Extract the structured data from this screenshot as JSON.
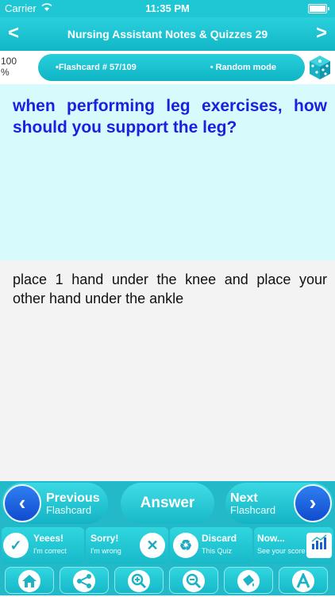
{
  "status": {
    "carrier": "Carrier",
    "time": "11:35 PM"
  },
  "nav": {
    "title": "Nursing Assistant Notes & Quizzes 29",
    "back": "<",
    "forward": ">"
  },
  "info": {
    "progress": "100 %",
    "flashcard_label": "•Flashcard #  57/109",
    "mode_label": "• Random mode"
  },
  "question": "when performing leg exercises, how should you support the leg?",
  "answer": "place 1 hand under the knee and place your other hand under the ankle",
  "controls": {
    "previous_title": "Previous",
    "previous_sub": "Flashcard",
    "answer_label": "Answer",
    "next_title": "Next",
    "next_sub": "Flashcard",
    "yeees_title": "Yeees!",
    "yeees_sub": "I'm correct",
    "sorry_title": "Sorry!",
    "sorry_sub": "I'm wrong",
    "discard_title": "Discard",
    "discard_sub": "This Quiz",
    "now_title": "Now...",
    "now_sub": "See your score"
  },
  "colors": {
    "accent": "#1ec7d3",
    "question_text": "#1c1ee0",
    "question_bg": "#d7fbfc"
  },
  "icons": [
    "wifi-icon",
    "battery-icon",
    "dice-icon",
    "check-icon",
    "cross-icon",
    "recycle-icon",
    "chart-icon",
    "home-icon",
    "share-icon",
    "zoom-in-icon",
    "zoom-out-icon",
    "paint-icon",
    "font-icon"
  ]
}
